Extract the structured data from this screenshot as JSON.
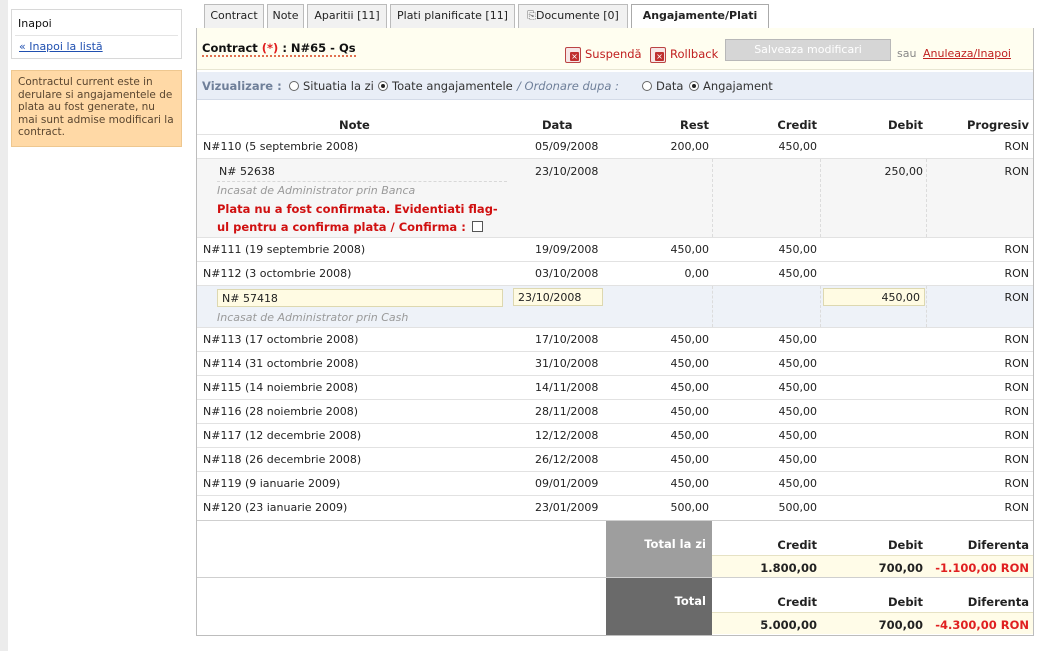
{
  "sidebar": {
    "back_title": "Inapoi",
    "back_link": "« Inapoi la listă",
    "info_text": "Contractul current este in derulare si angajamentele de plata au fost generate, nu mai sunt admise modificari la contract."
  },
  "tabs": [
    {
      "label": "Contract"
    },
    {
      "label": "Note"
    },
    {
      "label": "Aparitii [11]"
    },
    {
      "label": "Plati planificate [11]"
    },
    {
      "label": "Documente [0]",
      "icon": "paperclip-icon"
    },
    {
      "label": "Angajamente/Plati",
      "active": true
    }
  ],
  "header": {
    "contract_prefix": "Contract ",
    "required_mark": "(*)",
    "contract_suffix": " : N#65 - Qs",
    "suspend_label": "Suspendă",
    "rollback_label": "Rollback",
    "save_label": "Salveaza modificari",
    "or_text": "sau",
    "cancel_label": "Anuleaza/Inapoi"
  },
  "view": {
    "label": "Vizualizare :",
    "option1": "Situatia la zi",
    "option2": "Toate angajamentele",
    "order_label": "/ Ordonare dupa :",
    "order1": "Data",
    "order2": "Angajament",
    "selected_view": "Toate angajamentele",
    "selected_order": "Angajament"
  },
  "table": {
    "headers": {
      "note": "Note",
      "data": "Data",
      "rest": "Rest",
      "credit": "Credit",
      "debit": "Debit",
      "progresiv": "Progresiv"
    },
    "rows": [
      {
        "note": "N#110 (5 septembrie 2008)",
        "data": "05/09/2008",
        "rest": "200,00",
        "credit": "450,00",
        "debit": "",
        "prog": "RON"
      },
      {
        "note": "N# 52638",
        "data": "23/10/2008",
        "rest": "",
        "credit": "",
        "debit": "250,00",
        "prog": "RON",
        "sub": "Incasat de Administrator prin Banca",
        "warning": "Plata nu a fost confirmata. Evidentiati flag-ul pentru a confirma plata / Confirma :"
      },
      {
        "note": "N#111 (19 septembrie 2008)",
        "data": "19/09/2008",
        "rest": "450,00",
        "credit": "450,00",
        "debit": "",
        "prog": "RON"
      },
      {
        "note": "N#112 (3 octombrie 2008)",
        "data": "03/10/2008",
        "rest": "0,00",
        "credit": "450,00",
        "debit": "",
        "prog": "RON"
      },
      {
        "note": "N# 57418",
        "data": "23/10/2008",
        "rest": "",
        "credit": "",
        "debit": "450,00",
        "prog": "RON",
        "sub": "Incasat de Administrator prin Cash"
      },
      {
        "note": "N#113 (17 octombrie 2008)",
        "data": "17/10/2008",
        "rest": "450,00",
        "credit": "450,00",
        "debit": "",
        "prog": "RON"
      },
      {
        "note": "N#114 (31 octombrie 2008)",
        "data": "31/10/2008",
        "rest": "450,00",
        "credit": "450,00",
        "debit": "",
        "prog": "RON"
      },
      {
        "note": "N#115 (14 noiembrie 2008)",
        "data": "14/11/2008",
        "rest": "450,00",
        "credit": "450,00",
        "debit": "",
        "prog": "RON"
      },
      {
        "note": "N#116 (28 noiembrie 2008)",
        "data": "28/11/2008",
        "rest": "450,00",
        "credit": "450,00",
        "debit": "",
        "prog": "RON"
      },
      {
        "note": "N#117 (12 decembrie 2008)",
        "data": "12/12/2008",
        "rest": "450,00",
        "credit": "450,00",
        "debit": "",
        "prog": "RON"
      },
      {
        "note": "N#118 (26 decembrie 2008)",
        "data": "26/12/2008",
        "rest": "450,00",
        "credit": "450,00",
        "debit": "",
        "prog": "RON"
      },
      {
        "note": "N#119 (9 ianuarie 2009)",
        "data": "09/01/2009",
        "rest": "450,00",
        "credit": "450,00",
        "debit": "",
        "prog": "RON"
      },
      {
        "note": "N#120 (23 ianuarie 2009)",
        "data": "23/01/2009",
        "rest": "500,00",
        "credit": "500,00",
        "debit": "",
        "prog": "RON"
      }
    ]
  },
  "totals": {
    "today": {
      "label": "Total la zi",
      "credit_h": "Credit",
      "debit_h": "Debit",
      "diff_h": "Diferenta",
      "credit": "1.800,00",
      "debit": "700,00",
      "diff": "-1.100,00 RON"
    },
    "total": {
      "label": "Total",
      "credit_h": "Credit",
      "debit_h": "Debit",
      "diff_h": "Diferenta",
      "credit": "5.000,00",
      "debit": "700,00",
      "diff": "-4.300,00 RON"
    }
  },
  "colors": {
    "accent_red": "#d01010",
    "total_today_bg": "#9e9e9e",
    "total_bg": "#6a6a6a",
    "info_bg": "#ffd9a6"
  }
}
